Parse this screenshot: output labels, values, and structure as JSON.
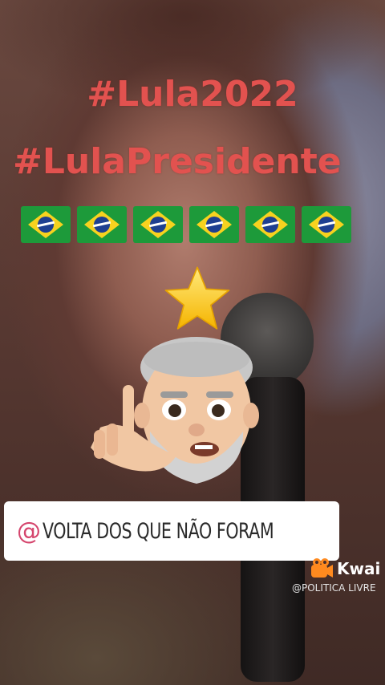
{
  "overlay": {
    "hashtag_1": "#Lula2022",
    "hashtag_2": "#LulaPresidente",
    "flag_emoji_count": 6,
    "flag_icon": "brazil-flag-icon",
    "sticker_icons": [
      "star-icon",
      "memoji-shush-icon"
    ]
  },
  "mention": {
    "at_symbol": "@",
    "text": "VOLTA DOS QUE NÃO FORAM"
  },
  "watermark": {
    "brand": "Kwai",
    "handle": "@POLITICA LIVRE"
  },
  "colors": {
    "hashtag": "#e2524f",
    "at_symbol": "#d5456d",
    "kwai_logo": "#ff8a1f"
  }
}
